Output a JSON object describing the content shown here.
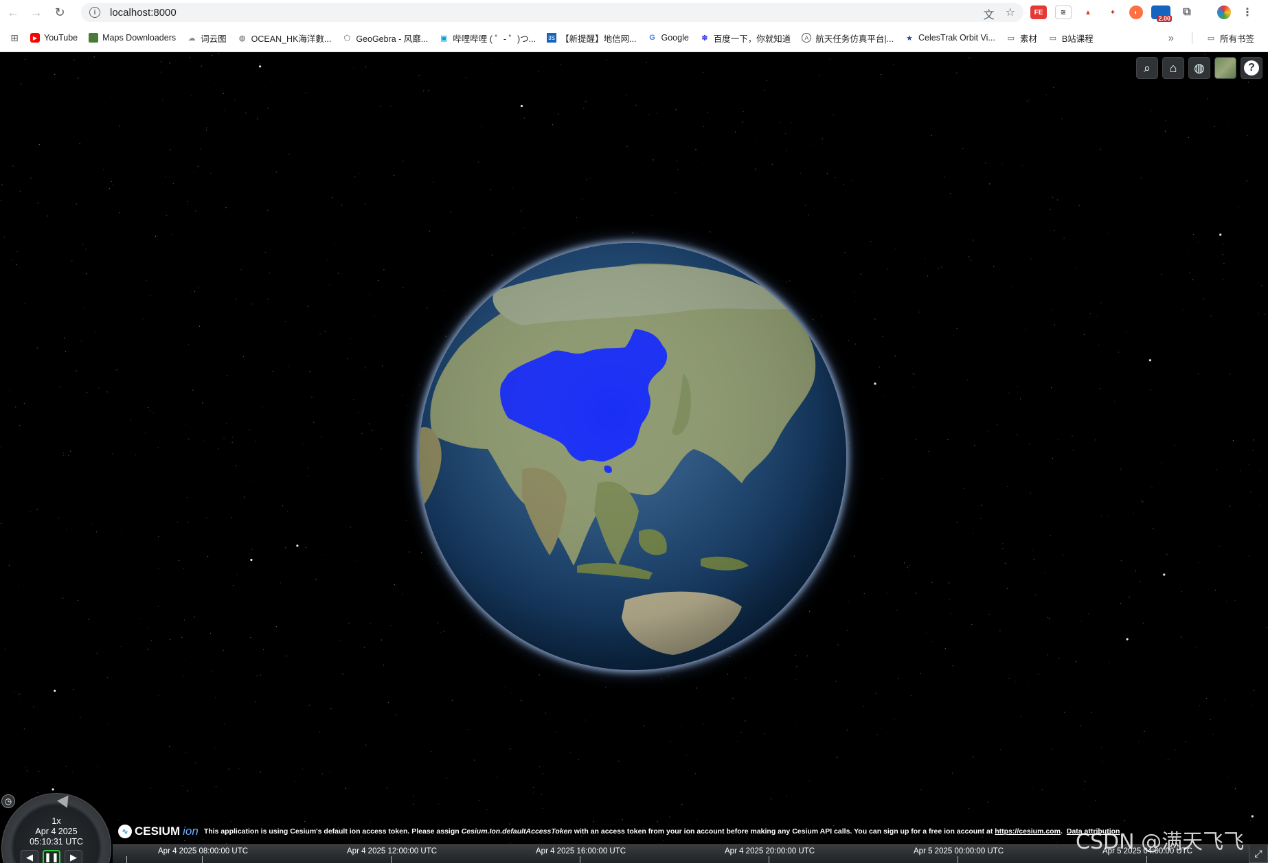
{
  "browser": {
    "url": "localhost:8000",
    "bookmarks": [
      {
        "label": "YouTube",
        "icon": "youtube-icon"
      },
      {
        "label": "Maps Downloaders",
        "icon": "map-icon"
      },
      {
        "label": "词云图",
        "icon": "cloud-icon"
      },
      {
        "label": "OCEAN_HK海洋數...",
        "icon": "globe-icon"
      },
      {
        "label": "GeoGebra - 风靡...",
        "icon": "geogebra-icon"
      },
      {
        "label": "哔哩哔哩 ( ゜- ゜)つ...",
        "icon": "bilibili-icon"
      },
      {
        "label": "【新提醒】地信网...",
        "icon": "3s-icon"
      },
      {
        "label": "Google",
        "icon": "google-icon"
      },
      {
        "label": "百度一下，你就知道",
        "icon": "baidu-icon"
      },
      {
        "label": "航天任务仿真平台|...",
        "icon": "satellite-icon"
      },
      {
        "label": "CelesTrak Orbit Vi...",
        "icon": "celestrak-icon"
      },
      {
        "label": "素材",
        "icon": "folder-icon"
      },
      {
        "label": "B站课程",
        "icon": "folder-icon"
      }
    ],
    "more_bookmarks": "»",
    "all_bookmarks": "所有书签",
    "ext_badge": "2.00"
  },
  "animation": {
    "speed": "1x",
    "date": "Apr 4 2025",
    "time": "05:10:31 UTC"
  },
  "credits": {
    "logo_text": "CESIUM",
    "logo_ion": "ion",
    "msg_prefix": "This application is using Cesium's default ion access token. Please assign",
    "msg_code": "Cesium.Ion.defaultAccessToken",
    "msg_suffix": "with an access token from your ion account before making any Cesium API calls. You can sign up for a free ion account at",
    "msg_link": "https://cesium.com",
    "data_attribution": "Data attribution"
  },
  "timeline": {
    "labels": [
      "Apr 4 2025 08:00:00 UTC",
      "Apr 4 2025 12:00:00 UTC",
      "Apr 4 2025 16:00:00 UTC",
      "Apr 4 2025 20:00:00 UTC",
      "Apr 5 2025 00:00:00 UTC",
      "Apr 5 2025 04:00:00 UTC"
    ]
  },
  "watermark": "CSDN @满天飞飞",
  "colors": {
    "highlight": "#1a2ff5",
    "land": "#8c9a6a",
    "ocean": "#1d4570"
  }
}
